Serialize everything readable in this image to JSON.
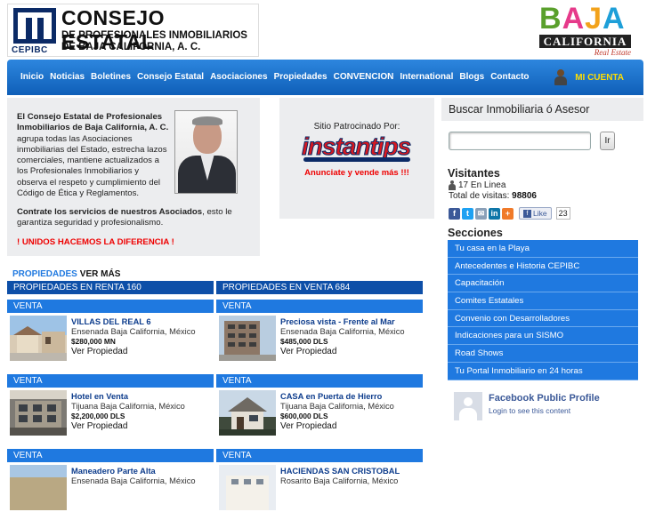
{
  "header": {
    "logo": {
      "abbr": "CEPIBC",
      "line1": "CONSEJO ESTATAL",
      "line2": "DE PROFESIONALES INMOBILIARIOS",
      "line3": "DE BAJA CALIFORNIA, A. C."
    },
    "baja_logo": {
      "letters": [
        "B",
        "A",
        "J",
        "A"
      ],
      "band": "CALIFORNIA",
      "tag": "Real Estate"
    }
  },
  "nav": {
    "items": [
      "Inicio",
      "Noticias",
      "Boletines",
      "Consejo Estatal",
      "Asociaciones",
      "Propiedades",
      "CONVENCION",
      "International",
      "Blogs",
      "Contacto"
    ],
    "account": "MI CUENTA"
  },
  "about": {
    "intro_bold": "El Consejo Estatal de Profesionales Inmobiliarios de Baja California, A. C.",
    "intro_rest": " agrupa todas las Asociaciones inmobiliarias del Estado, estrecha lazos comerciales, mantiene actualizados a los Profesionales Inmobiliarios y observa el respeto y cumplimiento del Código de Ética y Reglamentos.",
    "cta_bold": "Contrate los servicios de nuestros Asociados",
    "cta_rest": ", esto le garantiza seguridad y profesionalismo.",
    "slogan": "! UNIDOS HACEMOS LA DIFERENCIA !"
  },
  "sponsor": {
    "label": "Sitio Patrocinado Por:",
    "brand": "instantips",
    "cta": "Anunciate y vende más !!!"
  },
  "search": {
    "title": "Buscar Inmobiliaria ó Asesor",
    "placeholder": "",
    "button": "Ir"
  },
  "visitors": {
    "title": "Visitantes",
    "online": "17 En Linea",
    "total_label": "Total de visitas:",
    "total_value": "98806",
    "like_label": "Like",
    "like_count": "23"
  },
  "sections": {
    "title": "Secciones",
    "items": [
      "Tu casa en la Playa",
      "Antecedentes e Historia CEPIBC",
      "Capacitación",
      "Comites Estatales",
      "Convenio con Desarrolladores",
      "Indicaciones para un SISMO",
      "Road Shows",
      "Tu Portal Inmobiliario en 24 horas"
    ]
  },
  "facebook": {
    "title": "Facebook Public Profile",
    "subtitle": "Login to see this content"
  },
  "properties": {
    "heading": "PROPIEDADES",
    "more": "VER MÁS",
    "rent_header": "PROPIEDADES EN RENTA 160",
    "sale_header": "PROPIEDADES EN VENTA 684",
    "link_label": "Ver Propiedad",
    "cards": [
      {
        "tag": "VENTA",
        "title": "VILLAS DEL REAL 6",
        "location": "Ensenada Baja California, México",
        "price": "$280,000 MN"
      },
      {
        "tag": "VENTA",
        "title": "Preciosa vista - Frente al Mar",
        "location": "Ensenada Baja California, México",
        "price": "$485,000 DLS"
      },
      {
        "tag": "VENTA",
        "title": "Hotel en Venta",
        "location": "Tijuana Baja California, México",
        "price": "$2,200,000 DLS"
      },
      {
        "tag": "VENTA",
        "title": "CASA en Puerta de Hierro",
        "location": "Tijuana Baja California, México",
        "price": "$600,000 DLS"
      },
      {
        "tag": "VENTA",
        "title": "Maneadero Parte Alta",
        "location": "Ensenada Baja California, México",
        "price": ""
      },
      {
        "tag": "VENTA",
        "title": "HACIENDAS SAN CRISTOBAL",
        "location": "Rosarito Baja California, México",
        "price": ""
      }
    ]
  },
  "colors": {
    "nav_blue": "#1f79e0",
    "dark_blue": "#0d4fa8",
    "alert_red": "#e00000",
    "account_yellow": "#ffde00"
  }
}
